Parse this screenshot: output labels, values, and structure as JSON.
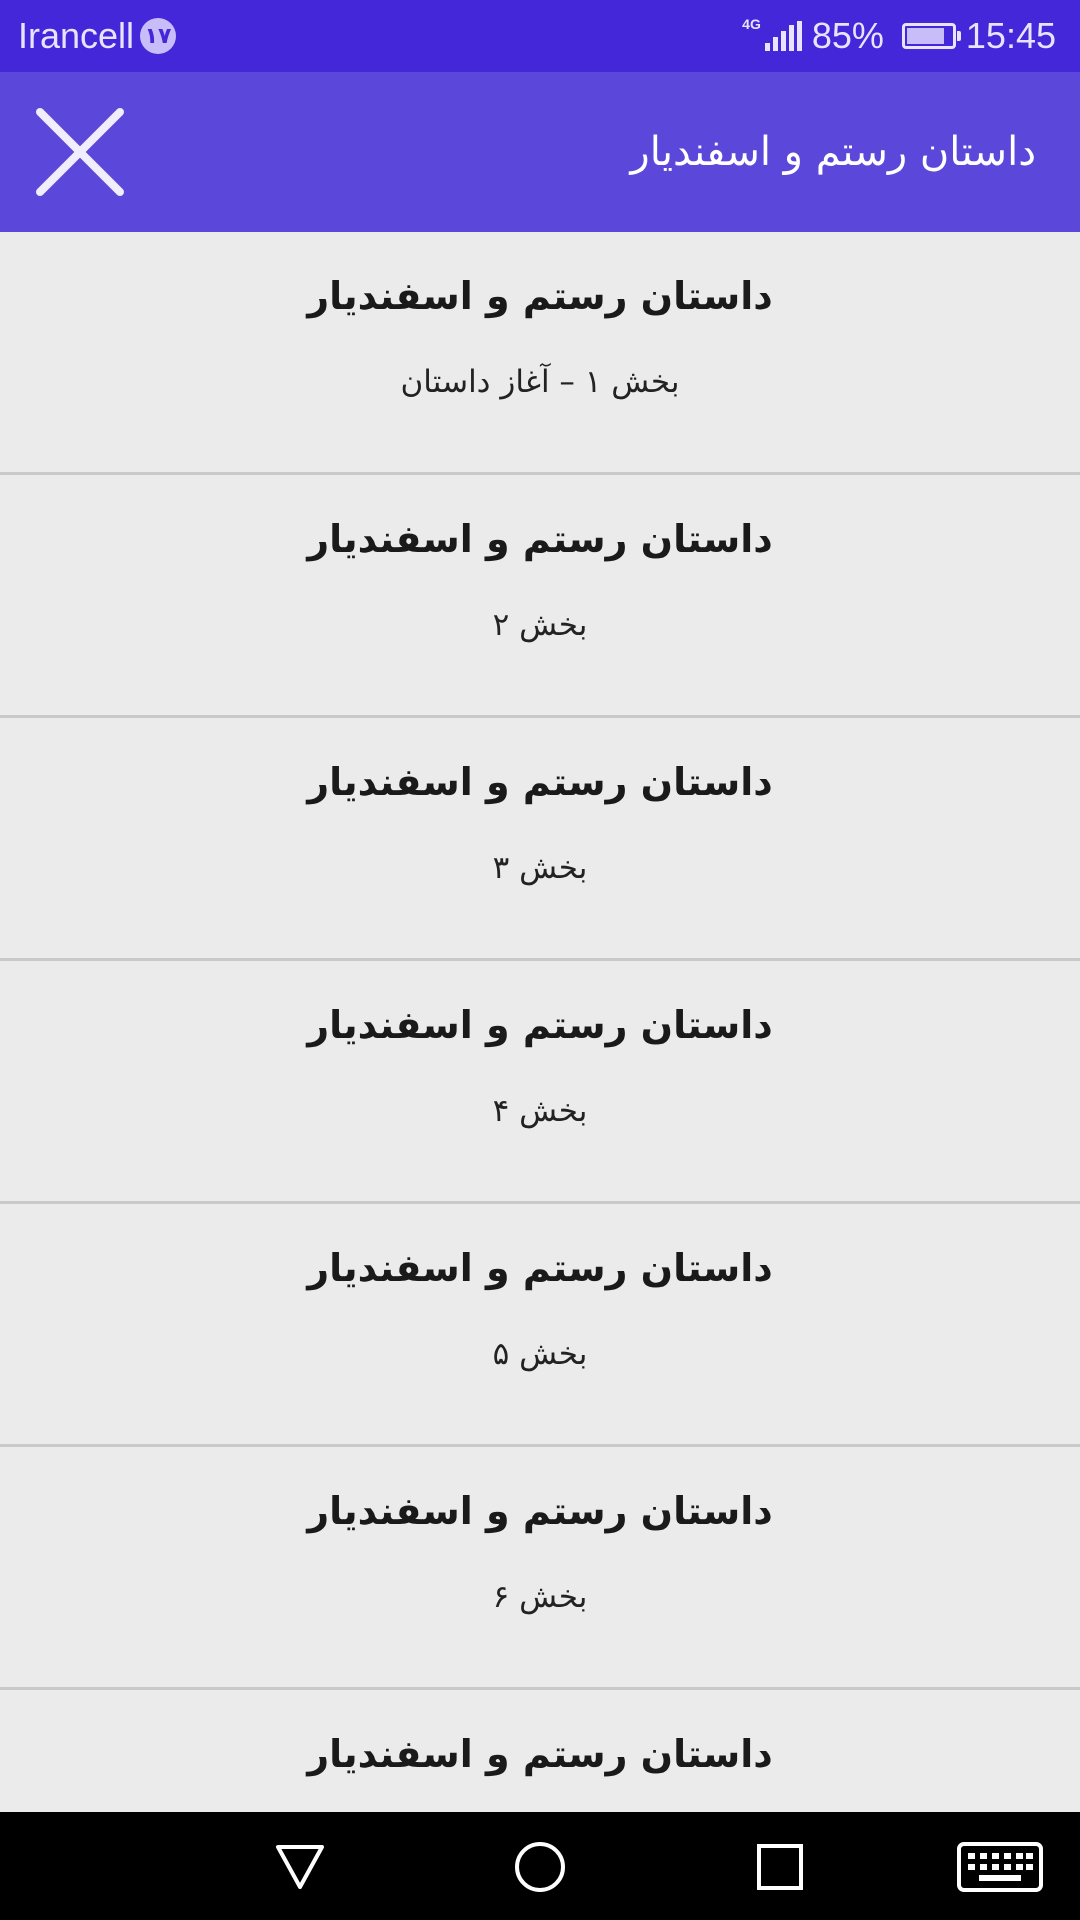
{
  "status_bar": {
    "carrier": "Irancell",
    "notification_count": "۱۷",
    "network": "4G",
    "battery": "85%",
    "battery_level": 0.85,
    "time": "15:45"
  },
  "app_bar": {
    "title": "داستان رستم و اسفندیار",
    "close_icon": "close-icon"
  },
  "list": {
    "items": [
      {
        "title": "داستان رستم و اسفندیار",
        "subtitle": "بخش ۱ – آغاز داستان"
      },
      {
        "title": "داستان رستم و اسفندیار",
        "subtitle": "بخش ۲"
      },
      {
        "title": "داستان رستم و اسفندیار",
        "subtitle": "بخش ۳"
      },
      {
        "title": "داستان رستم و اسفندیار",
        "subtitle": "بخش ۴"
      },
      {
        "title": "داستان رستم و اسفندیار",
        "subtitle": "بخش ۵"
      },
      {
        "title": "داستان رستم و اسفندیار",
        "subtitle": "بخش ۶"
      },
      {
        "title": "داستان رستم و اسفندیار",
        "subtitle": ""
      }
    ]
  },
  "nav_bar": {
    "icons": [
      "back-icon",
      "home-icon",
      "recents-icon",
      "keyboard-icon"
    ]
  },
  "colors": {
    "status_bar": "#4427d8",
    "app_bar": "#5b47d9",
    "list_background": "#ebebeb",
    "divider": "#c9c9c9",
    "nav_bar": "#000000"
  }
}
